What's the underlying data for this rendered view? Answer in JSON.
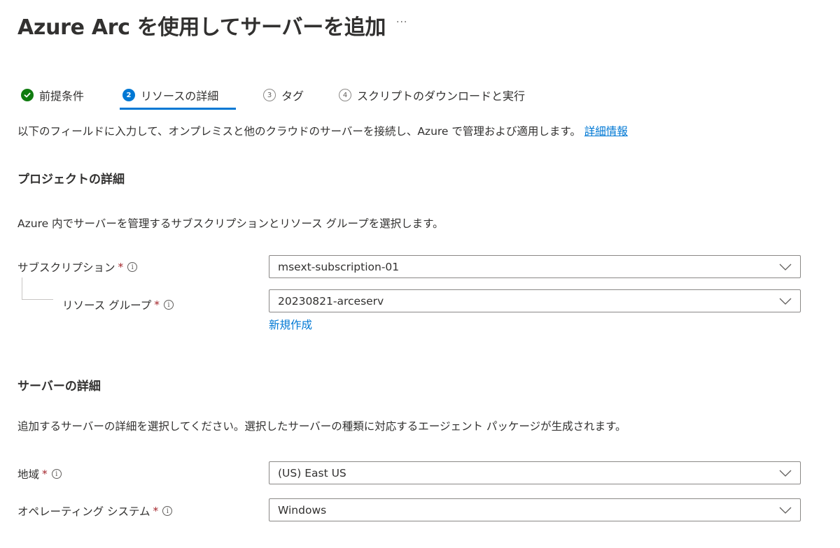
{
  "page": {
    "title": "Azure Arc を使用してサーバーを追加",
    "more": "···"
  },
  "tabs": [
    {
      "number": "",
      "label": "前提条件",
      "state": "done"
    },
    {
      "number": "2",
      "label": "リソースの詳細",
      "state": "active"
    },
    {
      "number": "3",
      "label": "タグ",
      "state": "pending"
    },
    {
      "number": "4",
      "label": "スクリプトのダウンロードと実行",
      "state": "pending"
    }
  ],
  "intro": {
    "text": "以下のフィールドに入力して、オンプレミスと他のクラウドのサーバーを接続し、Azure で管理および適用します。",
    "link": "詳細情報"
  },
  "project": {
    "heading": "プロジェクトの詳細",
    "description": "Azure 内でサーバーを管理するサブスクリプションとリソース グループを選択します。",
    "subscription": {
      "label": "サブスクリプション",
      "required": "*",
      "value": "msext-subscription-01"
    },
    "resource_group": {
      "label": "リソース グループ",
      "required": "*",
      "value": "20230821-arceserv",
      "create_new": "新規作成"
    }
  },
  "server": {
    "heading": "サーバーの詳細",
    "description": "追加するサーバーの詳細を選択してください。選択したサーバーの種類に対応するエージェント パッケージが生成されます。",
    "region": {
      "label": "地域",
      "required": "*",
      "value": "(US) East US"
    },
    "os": {
      "label": "オペレーティング システム",
      "required": "*",
      "value": "Windows"
    }
  },
  "icons": {
    "info": "i",
    "check": "✓"
  },
  "colors": {
    "accent": "#0078d4",
    "success": "#107c10",
    "required": "#a4262c",
    "text": "#323130"
  }
}
